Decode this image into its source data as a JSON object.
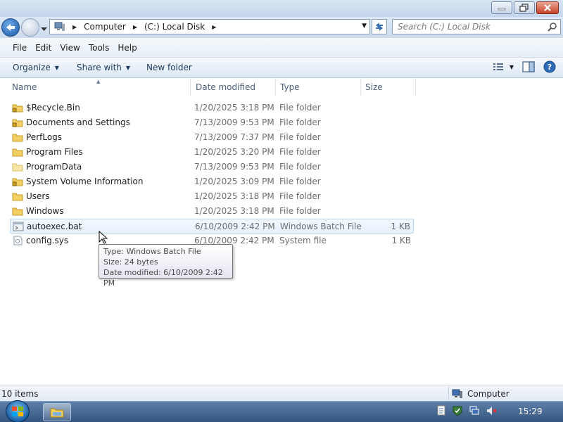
{
  "address": {
    "crumbs": [
      "Computer",
      "(C:) Local Disk"
    ]
  },
  "search": {
    "placeholder": "Search (C:) Local Disk"
  },
  "menu": [
    "File",
    "Edit",
    "View",
    "Tools",
    "Help"
  ],
  "toolbar": {
    "organize": "Organize",
    "share_with": "Share with",
    "new_folder": "New folder"
  },
  "columns": {
    "name": "Name",
    "date_modified": "Date modified",
    "type": "Type",
    "size": "Size"
  },
  "files": [
    {
      "name": "$Recycle.Bin",
      "date": "1/20/2025 3:18 PM",
      "type": "File folder",
      "size": "",
      "icon": "locked-folder-icon"
    },
    {
      "name": "Documents and Settings",
      "date": "7/13/2009 9:53 PM",
      "type": "File folder",
      "size": "",
      "icon": "locked-folder-icon"
    },
    {
      "name": "PerfLogs",
      "date": "7/13/2009 7:37 PM",
      "type": "File folder",
      "size": "",
      "icon": "folder-icon"
    },
    {
      "name": "Program Files",
      "date": "1/20/2025 3:20 PM",
      "type": "File folder",
      "size": "",
      "icon": "folder-icon"
    },
    {
      "name": "ProgramData",
      "date": "7/13/2009 9:53 PM",
      "type": "File folder",
      "size": "",
      "icon": "folder-icon"
    },
    {
      "name": "System Volume Information",
      "date": "1/20/2025 3:09 PM",
      "type": "File folder",
      "size": "",
      "icon": "locked-folder-icon"
    },
    {
      "name": "Users",
      "date": "1/20/2025 3:18 PM",
      "type": "File folder",
      "size": "",
      "icon": "folder-icon"
    },
    {
      "name": "Windows",
      "date": "1/20/2025 3:18 PM",
      "type": "File folder",
      "size": "",
      "icon": "folder-icon"
    },
    {
      "name": "autoexec.bat",
      "date": "6/10/2009 2:42 PM",
      "type": "Windows Batch File",
      "size": "1 KB",
      "icon": "batch-file-icon"
    },
    {
      "name": "config.sys",
      "date": "6/10/2009 2:42 PM",
      "type": "System file",
      "size": "1 KB",
      "icon": "system-file-icon"
    }
  ],
  "tooltip": {
    "type": "Type: Windows Batch File",
    "size": "Size: 24 bytes",
    "date": "Date modified: 6/10/2009 2:42 PM"
  },
  "status": {
    "item_count": "10 items",
    "location": "Computer"
  },
  "taskbar": {
    "clock": "15:29"
  }
}
